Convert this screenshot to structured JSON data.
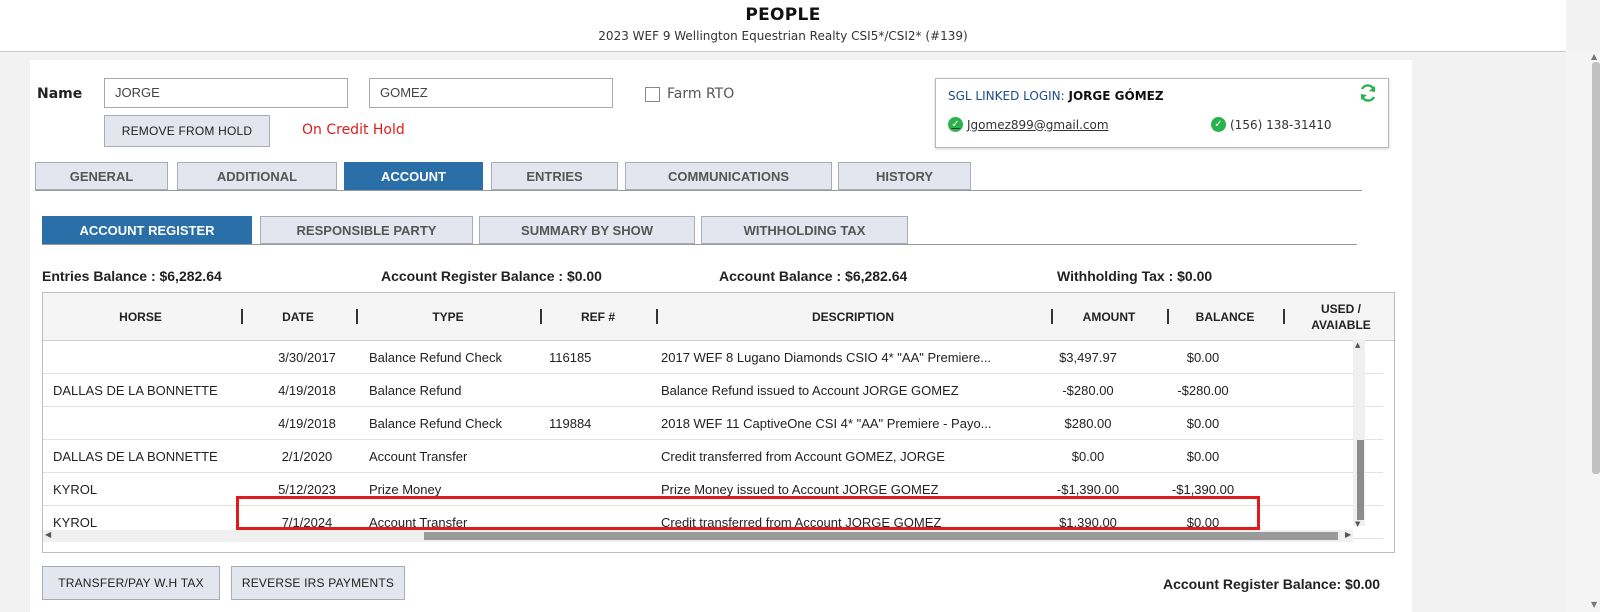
{
  "header": {
    "title": "PEOPLE",
    "subtitle": "2023 WEF 9 Wellington Equestrian Realty CSI5*/CSI2* (#139)"
  },
  "person": {
    "name_label": "Name",
    "first_name": "JORGE",
    "last_name": "GOMEZ",
    "farm_rto_label": "Farm RTO",
    "farm_rto_checked": false,
    "remove_hold_label": "REMOVE FROM HOLD",
    "credit_status": "On Credit Hold"
  },
  "linked_login": {
    "label": "SGL LINKED LOGIN:",
    "name": "JORGE GÓMEZ",
    "email": "Jgomez899@gmail.com",
    "phone": "(156) 138-31410"
  },
  "main_tabs": [
    {
      "label": "GENERAL",
      "active": false
    },
    {
      "label": "ADDITIONAL",
      "active": false
    },
    {
      "label": "ACCOUNT",
      "active": true
    },
    {
      "label": "ENTRIES",
      "active": false
    },
    {
      "label": "COMMUNICATIONS",
      "active": false
    },
    {
      "label": "HISTORY",
      "active": false
    }
  ],
  "sub_tabs": [
    {
      "label": "ACCOUNT REGISTER",
      "active": true
    },
    {
      "label": "RESPONSIBLE PARTY",
      "active": false
    },
    {
      "label": "SUMMARY BY SHOW",
      "active": false
    },
    {
      "label": "WITHHOLDING TAX",
      "active": false
    }
  ],
  "balances": {
    "entries": "Entries Balance : $6,282.64",
    "account_register": "Account Register Balance : $0.00",
    "account": "Account Balance : $6,282.64",
    "withholding": "Withholding Tax : $0.00"
  },
  "table": {
    "columns": [
      "HORSE",
      "DATE",
      "TYPE",
      "REF #",
      "DESCRIPTION",
      "AMOUNT",
      "BALANCE",
      "USED /\nAVAIABLE"
    ],
    "rows": [
      {
        "horse": "",
        "date": "3/30/2017",
        "type": "Balance Refund Check",
        "ref": "116185",
        "description": "2017 WEF 8 Lugano Diamonds CSIO 4* \"AA\" Premiere...",
        "amount": "$3,497.97",
        "balance": "$0.00"
      },
      {
        "horse": "DALLAS DE LA BONNETTE",
        "date": "4/19/2018",
        "type": "Balance Refund",
        "ref": "",
        "description": "Balance Refund issued to Account JORGE GOMEZ",
        "amount": "-$280.00",
        "balance": "-$280.00"
      },
      {
        "horse": "",
        "date": "4/19/2018",
        "type": "Balance Refund Check",
        "ref": "119884",
        "description": "2018 WEF 11 CaptiveOne CSI 4* \"AA\" Premiere - Payo...",
        "amount": "$280.00",
        "balance": "$0.00"
      },
      {
        "horse": "DALLAS DE LA BONNETTE",
        "date": "2/1/2020",
        "type": "Account Transfer",
        "ref": "",
        "description": "Credit transferred from Account GOMEZ, JORGE",
        "amount": "$0.00",
        "balance": "$0.00"
      },
      {
        "horse": "KYROL",
        "date": "5/12/2023",
        "type": "Prize Money",
        "ref": "",
        "description": "Prize Money issued to Account JORGE GOMEZ",
        "amount": "-$1,390.00",
        "balance": "-$1,390.00"
      },
      {
        "horse": "KYROL",
        "date": "7/1/2024",
        "type": "Account Transfer",
        "ref": "",
        "description": "Credit transferred from Account JORGE GOMEZ",
        "amount": "$1,390.00",
        "balance": "$0.00"
      }
    ]
  },
  "footer": {
    "transfer_label": "TRANSFER/PAY W.H TAX",
    "reverse_label": "REVERSE IRS PAYMENTS",
    "register_balance": "Account Register Balance: $0.00"
  },
  "colors": {
    "active_tab": "#2a6fa7",
    "inactive_tab": "#e3e6ee",
    "credit_hold": "#e01b1b",
    "verified_check": "#2bb24c",
    "highlight": "#e01b1b"
  },
  "icons": [
    "refresh-icon",
    "check-circle-icon"
  ]
}
